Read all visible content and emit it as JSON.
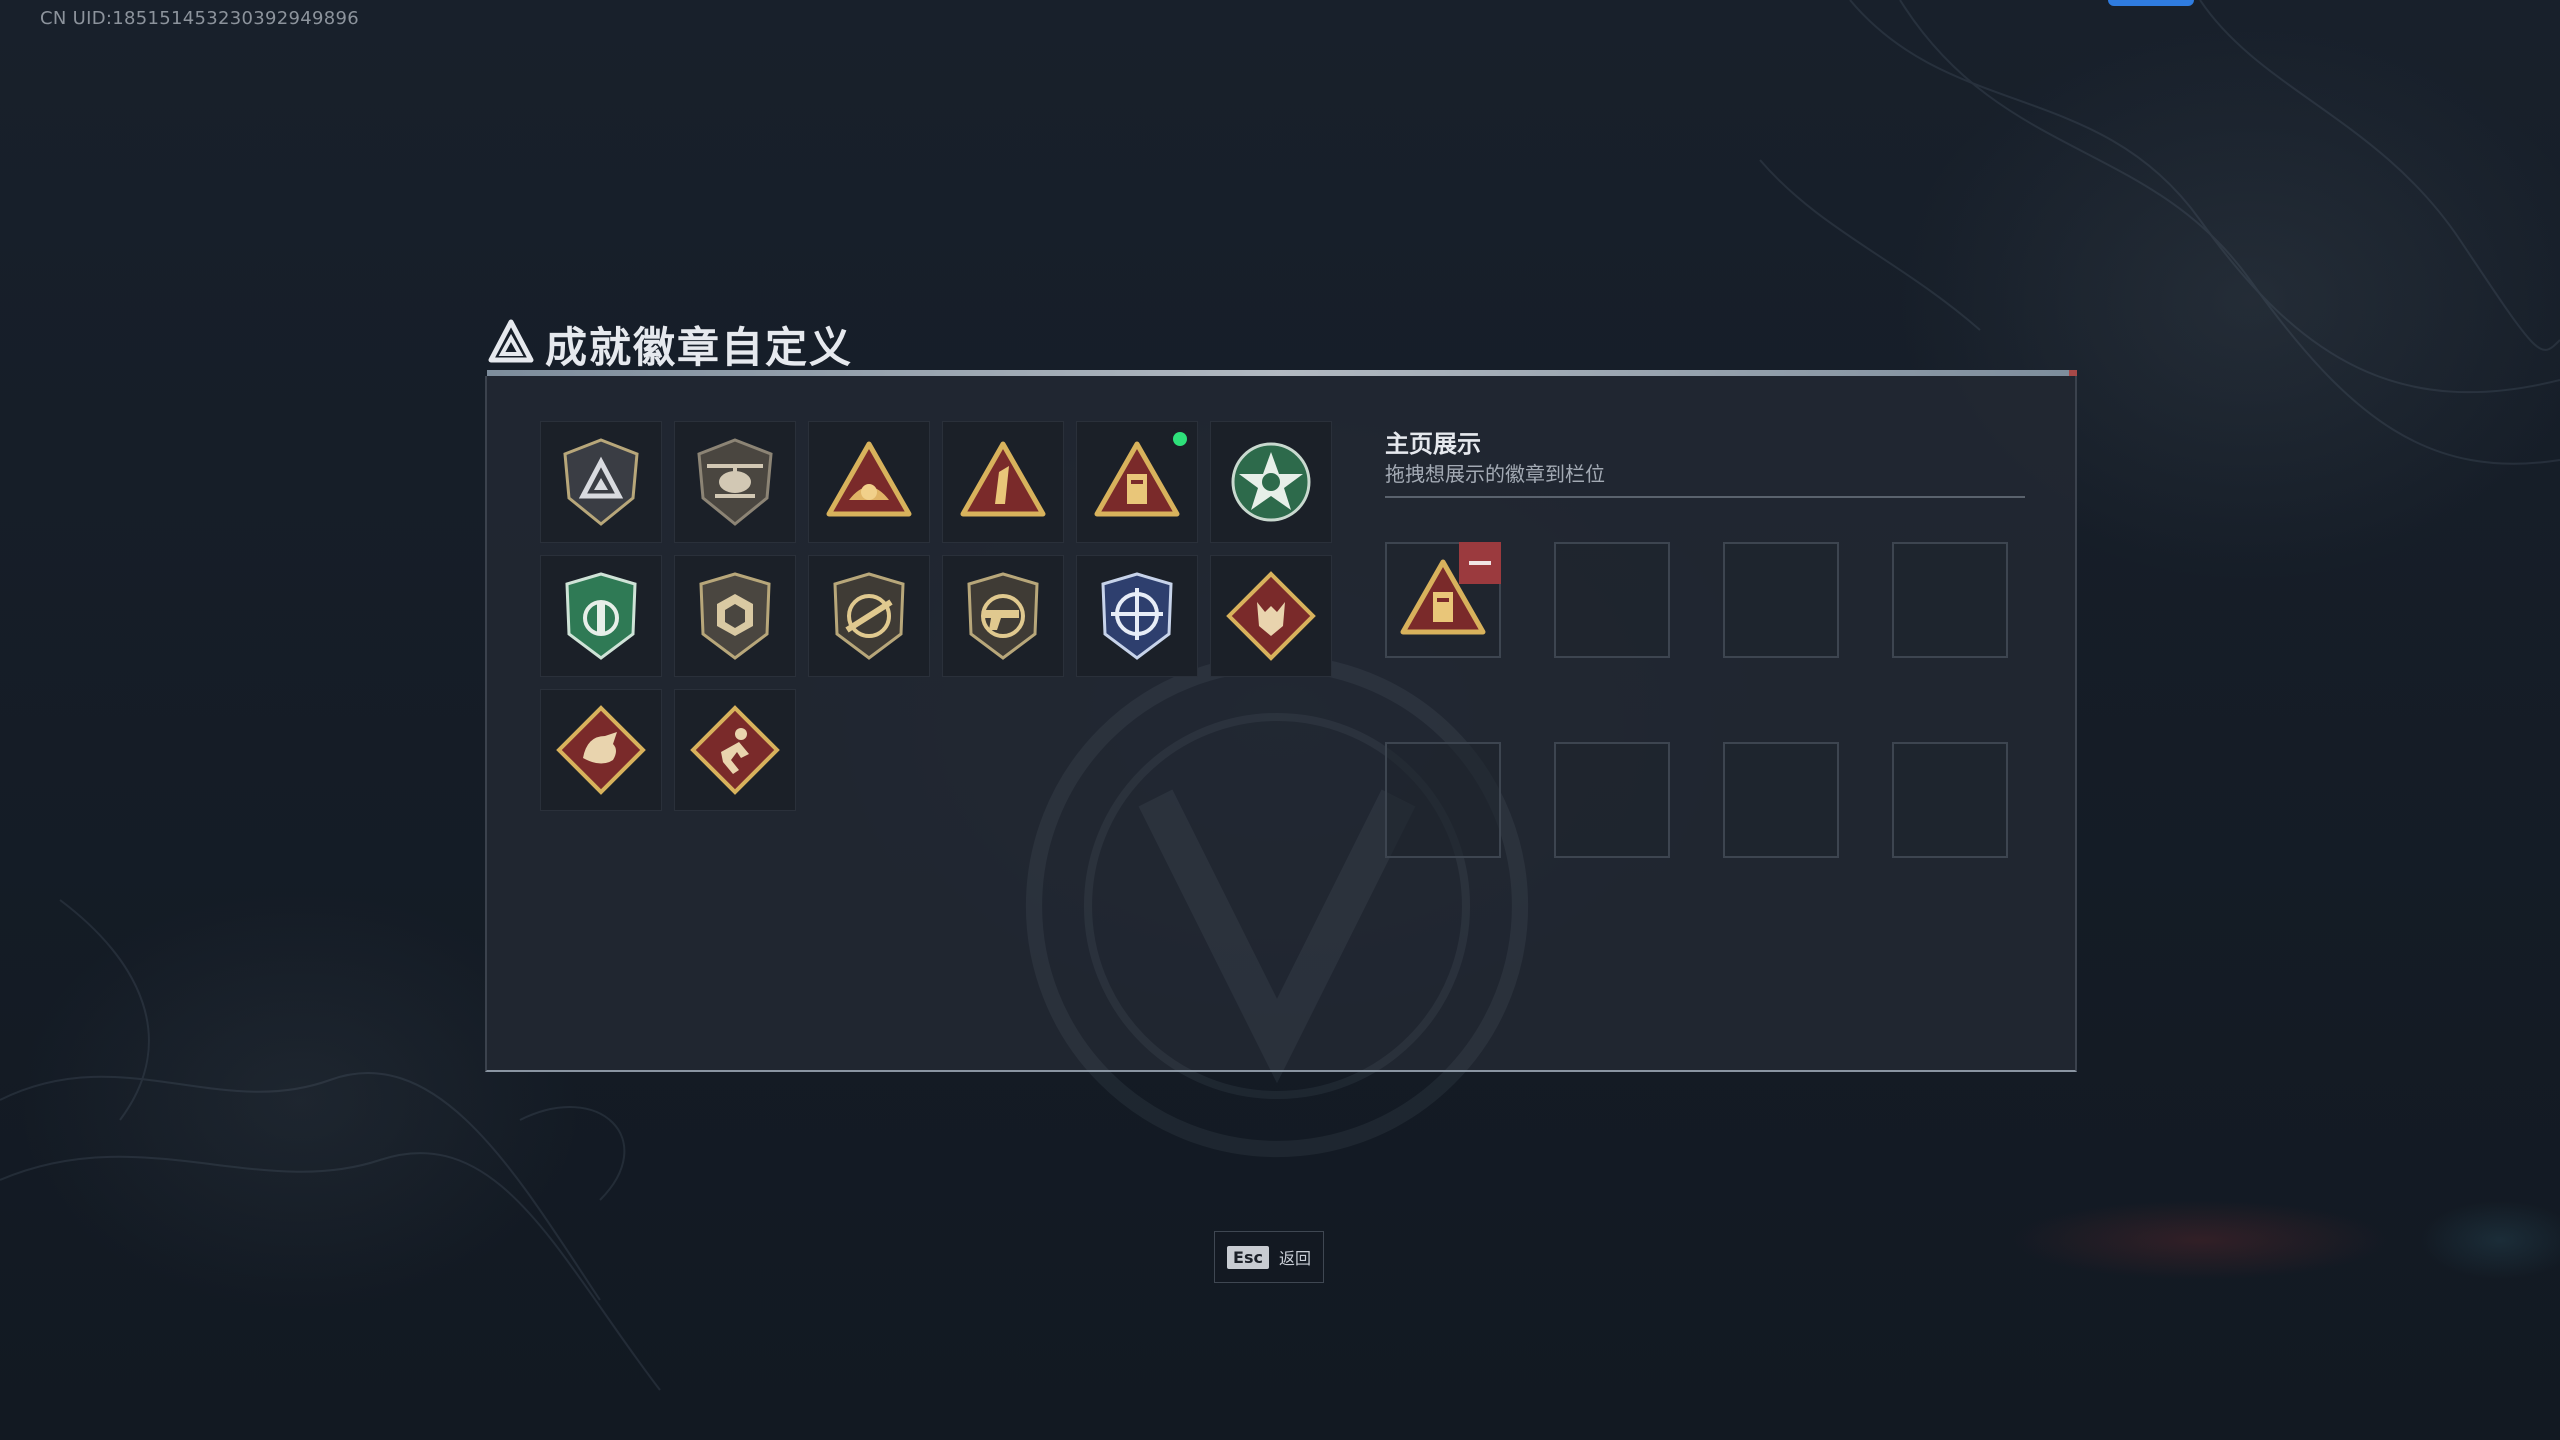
{
  "account": {
    "uid_text": "CN UID:185151453230392949896"
  },
  "header": {
    "title": "成就徽章自定义",
    "logo_icon": "delta-triangle-logo-icon"
  },
  "badges": [
    {
      "name": "shield-triangle-badge-icon",
      "active": false
    },
    {
      "name": "helicopter-badge-icon",
      "active": false
    },
    {
      "name": "triangle-eye-badge-icon",
      "active": false
    },
    {
      "name": "triangle-number-one-badge-icon",
      "active": false
    },
    {
      "name": "triangle-tower-badge-icon",
      "active": true
    },
    {
      "name": "green-star-medal-badge-icon",
      "active": false
    },
    {
      "name": "green-shield-badge-icon",
      "active": false
    },
    {
      "name": "hexagon-shield-badge-icon",
      "active": false
    },
    {
      "name": "rifle-shield-badge-icon",
      "active": false
    },
    {
      "name": "pistol-shield-badge-icon",
      "active": false
    },
    {
      "name": "blue-crosshair-badge-icon",
      "active": false
    },
    {
      "name": "wolf-diamond-badge-icon",
      "active": false
    },
    {
      "name": "dragon-diamond-badge-icon",
      "active": false
    },
    {
      "name": "runner-diamond-badge-icon",
      "active": false
    }
  ],
  "display": {
    "title": "主页展示",
    "subtitle": "拖拽想展示的徽章到栏位",
    "slots": [
      {
        "badge": "triangle-tower-badge-icon"
      },
      {
        "badge": null
      },
      {
        "badge": null
      },
      {
        "badge": null
      },
      {
        "badge": null
      },
      {
        "badge": null
      },
      {
        "badge": null
      },
      {
        "badge": null
      }
    ]
  },
  "footer": {
    "esc_key": "Esc",
    "back_label": "返回"
  },
  "colors": {
    "accent_blue": "#2f7ce0",
    "remove_red": "#9b3a3e",
    "active_green": "#2ee07a",
    "gold": "#c9a45a"
  }
}
